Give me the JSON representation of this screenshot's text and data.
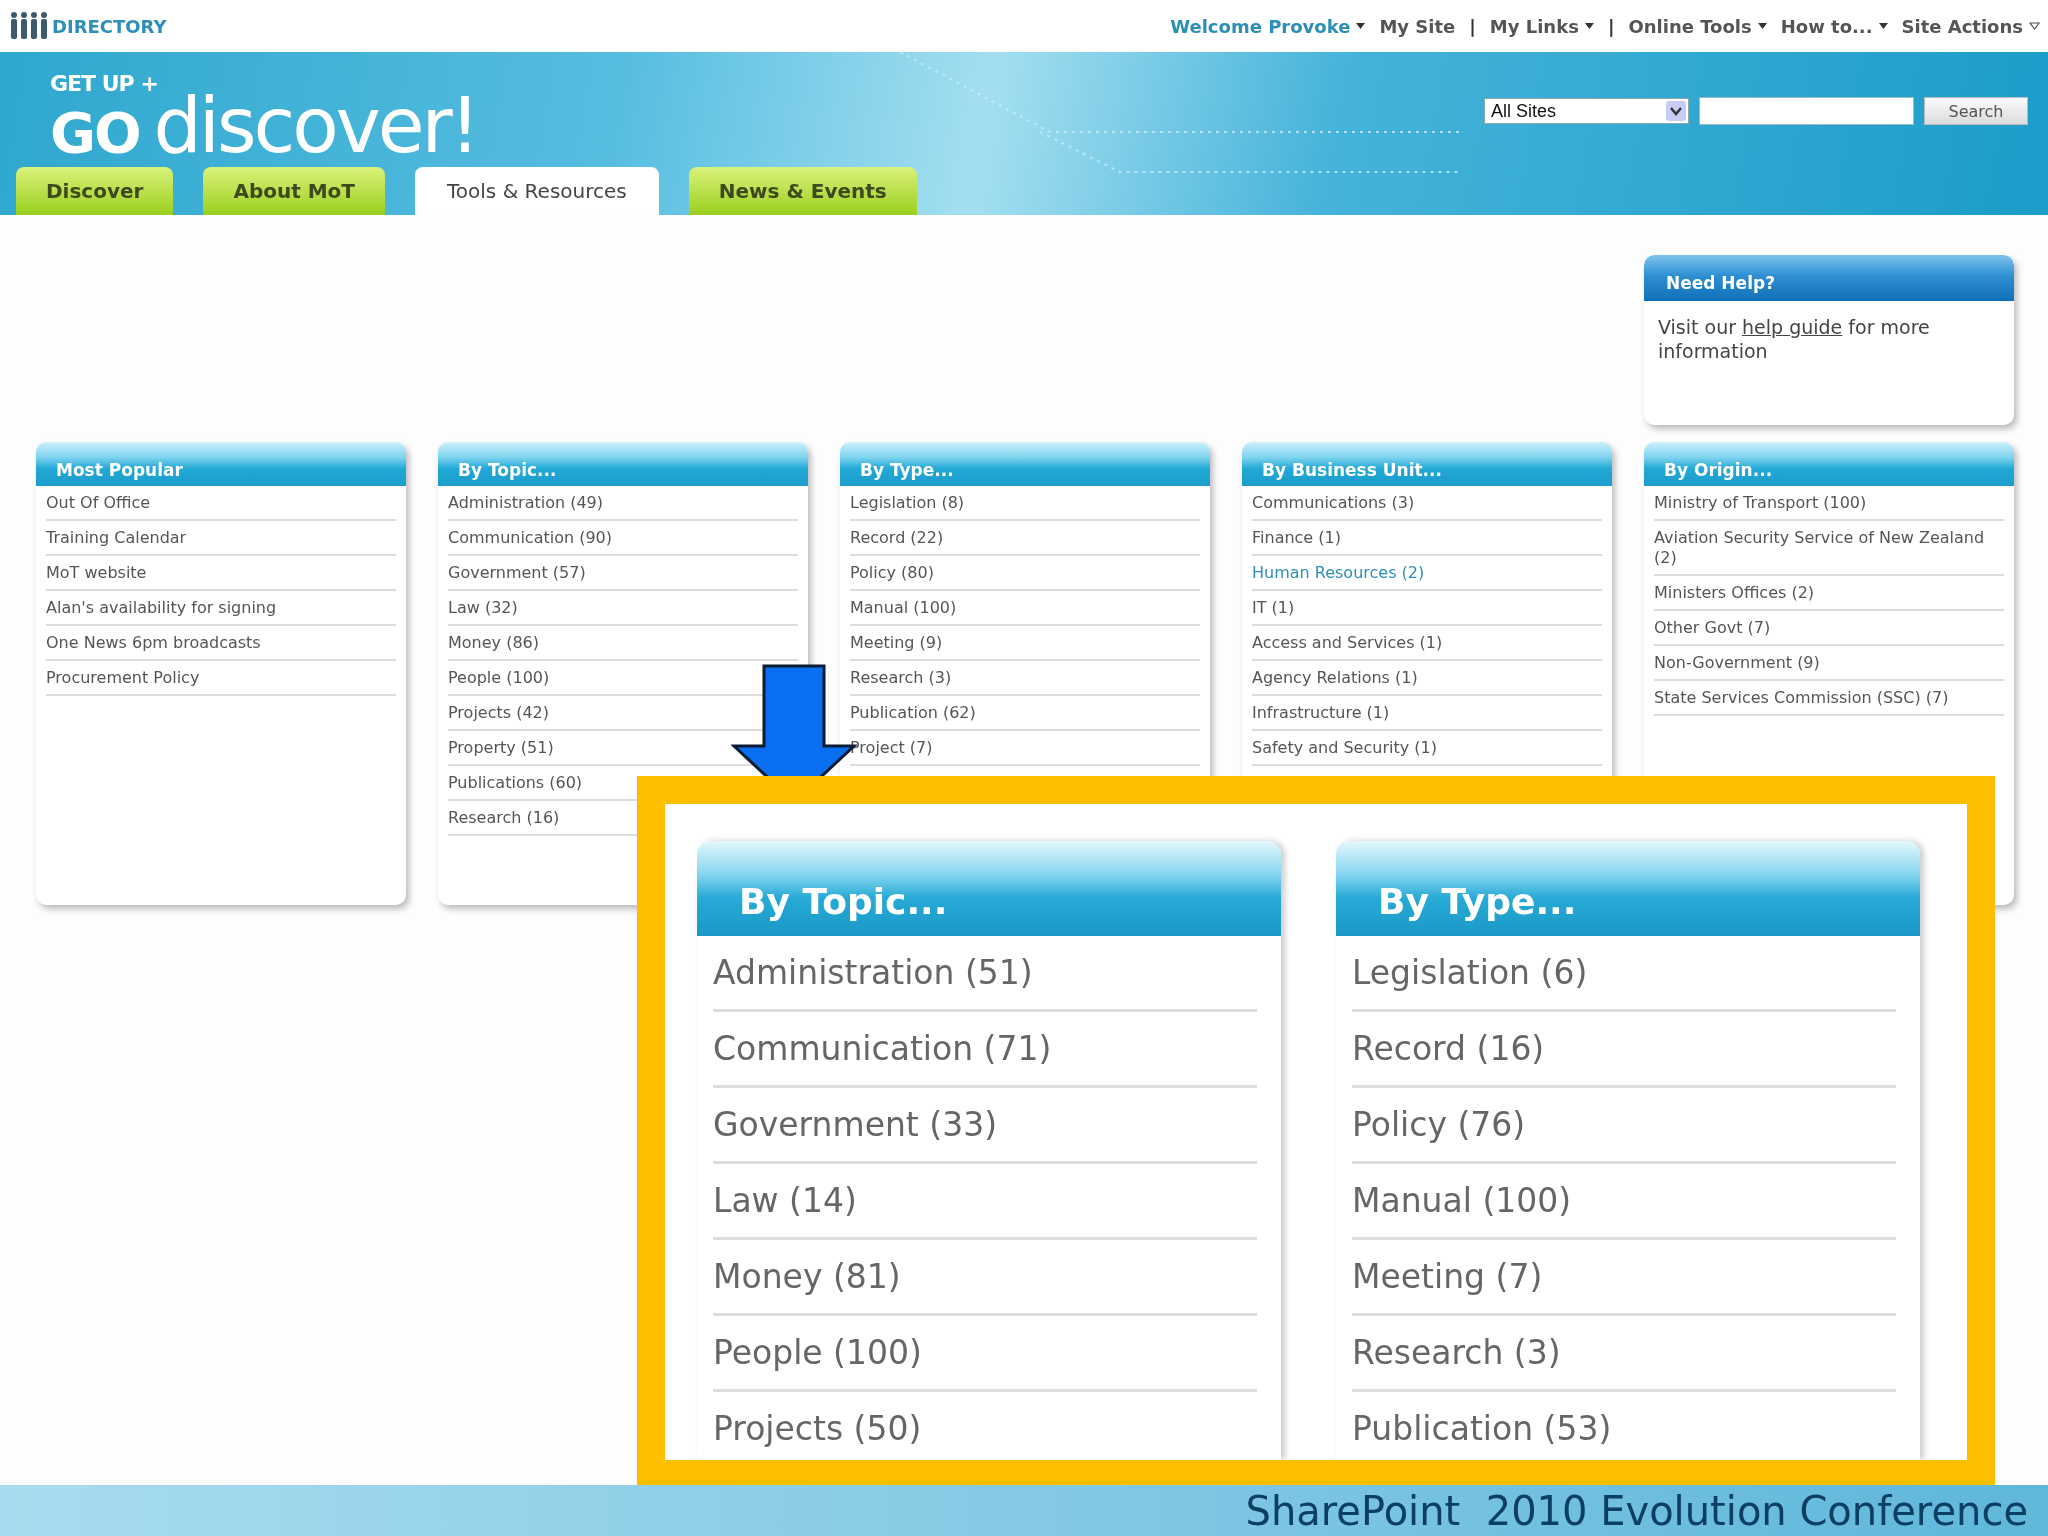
{
  "top_bar": {
    "directory": "DIRECTORY",
    "links": [
      {
        "kind": "user",
        "label": "Welcome Provoke",
        "dropdown": true
      },
      {
        "kind": "link",
        "label": "My Site",
        "dropdown": false
      },
      {
        "kind": "separator",
        "label": "|"
      },
      {
        "kind": "link",
        "label": "My Links",
        "dropdown": true
      },
      {
        "kind": "separator",
        "label": "|"
      },
      {
        "kind": "link",
        "label": "Online Tools",
        "dropdown": true
      },
      {
        "kind": "link",
        "label": "How to...",
        "dropdown": true
      },
      {
        "kind": "actions",
        "label": "Site Actions",
        "dropdown": true
      }
    ]
  },
  "banner": {
    "logo_top": "GET UP +",
    "logo_go": "GO",
    "logo_word": "discover!",
    "search": {
      "scope": "All Sites",
      "button": "Search"
    }
  },
  "tabs": [
    {
      "label": "Discover",
      "selected": false
    },
    {
      "label": "About MoT",
      "selected": false
    },
    {
      "label": "Tools & Resources",
      "selected": true
    },
    {
      "label": "News & Events",
      "selected": false
    }
  ],
  "help_box": {
    "title": "Need Help?",
    "text_before": "Visit our",
    "link": "help guide",
    "text_after": "for more information"
  },
  "columns": [
    {
      "title": "Most Popular",
      "items": [
        {
          "label": "Out Of Office",
          "selected": false
        },
        {
          "label": "Training Calendar",
          "selected": false
        },
        {
          "label": "MoT website",
          "selected": false
        },
        {
          "label": "Alan's availability for signing",
          "selected": false
        },
        {
          "label": "One News 6pm broadcasts",
          "selected": false
        },
        {
          "label": "Procurement Policy",
          "selected": false
        }
      ]
    },
    {
      "title": "By Topic...",
      "items": [
        {
          "label": "Administration (49)",
          "selected": false
        },
        {
          "label": "Communication (90)",
          "selected": false
        },
        {
          "label": "Government (57)",
          "selected": false
        },
        {
          "label": "Law (32)",
          "selected": false
        },
        {
          "label": "Money (86)",
          "selected": false
        },
        {
          "label": "People (100)",
          "selected": false
        },
        {
          "label": "Projects (42)",
          "selected": false
        },
        {
          "label": "Property (51)",
          "selected": false
        },
        {
          "label": "Publications (60)",
          "selected": false
        },
        {
          "label": "Research (16)",
          "selected": false
        }
      ]
    },
    {
      "title": "By Type...",
      "items": [
        {
          "label": "Legislation (8)",
          "selected": false
        },
        {
          "label": "Record (22)",
          "selected": false
        },
        {
          "label": "Policy (80)",
          "selected": false
        },
        {
          "label": "Manual (100)",
          "selected": false
        },
        {
          "label": "Meeting (9)",
          "selected": false
        },
        {
          "label": "Research (3)",
          "selected": false
        },
        {
          "label": "Publication (62)",
          "selected": false
        },
        {
          "label": "Project (7)",
          "selected": false
        }
      ]
    },
    {
      "title": "By Business Unit...",
      "items": [
        {
          "label": "Communications (3)",
          "selected": false
        },
        {
          "label": "Finance (1)",
          "selected": false
        },
        {
          "label": "Human Resources (2)",
          "selected": true
        },
        {
          "label": "IT (1)",
          "selected": false
        },
        {
          "label": "Access and Services (1)",
          "selected": false
        },
        {
          "label": "Agency Relations (1)",
          "selected": false
        },
        {
          "label": "Infrastructure (1)",
          "selected": false
        },
        {
          "label": "Safety and Security (1)",
          "selected": false
        }
      ]
    },
    {
      "title": "By Origin...",
      "items": [
        {
          "label": "Ministry of Transport (100)",
          "selected": false
        },
        {
          "label": "Aviation Security Service of New Zealand (2)",
          "selected": false
        },
        {
          "label": "Ministers Offices (2)",
          "selected": false
        },
        {
          "label": "Other Govt (7)",
          "selected": false
        },
        {
          "label": "Non-Government (9)",
          "selected": false
        },
        {
          "label": "State Services Commission (SSC) (7)",
          "selected": false
        }
      ]
    }
  ],
  "callout": {
    "panels": [
      {
        "title": "By Topic...",
        "items": [
          "Administration (51)",
          "Communication (71)",
          "Government (33)",
          "Law (14)",
          "Money (81)",
          "People (100)",
          "Projects (50)"
        ]
      },
      {
        "title": "By Type...",
        "items": [
          "Legislation (6)",
          "Record (16)",
          "Policy (76)",
          "Manual (100)",
          "Meeting (7)",
          "Research (3)",
          "Publication (53)"
        ]
      }
    ]
  },
  "footer": {
    "text": "SharePoint  2010 Evolution Conference"
  }
}
